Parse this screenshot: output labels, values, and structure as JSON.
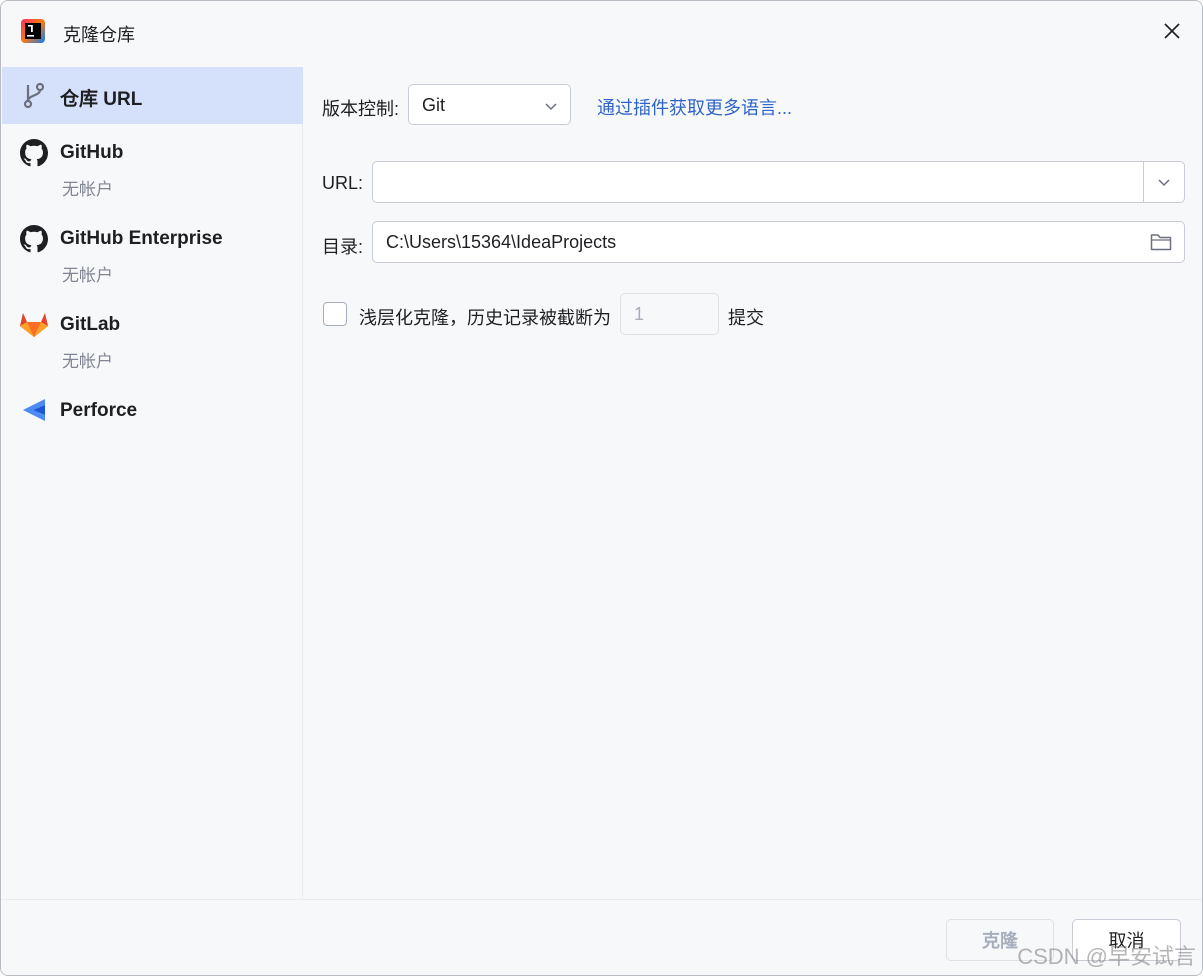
{
  "window": {
    "title": "克隆仓库"
  },
  "sidebar": {
    "items": [
      {
        "label": "仓库 URL",
        "sub": "",
        "icon": "branch-icon",
        "selected": true
      },
      {
        "label": "GitHub",
        "sub": "无帐户",
        "icon": "github-icon",
        "selected": false
      },
      {
        "label": "GitHub Enterprise",
        "sub": "无帐户",
        "icon": "github-icon",
        "selected": false
      },
      {
        "label": "GitLab",
        "sub": "无帐户",
        "icon": "gitlab-icon",
        "selected": false
      },
      {
        "label": "Perforce",
        "sub": "",
        "icon": "perforce-icon",
        "selected": false
      }
    ]
  },
  "form": {
    "vcs_label": "版本控制:",
    "vcs_value": "Git",
    "plugins_link": "通过插件获取更多语言...",
    "url_label": "URL:",
    "url_value": "",
    "dir_label": "目录:",
    "dir_value": "C:\\Users\\15364\\IdeaProjects",
    "shallow_label": "浅层化克隆，历史记录被截断为",
    "shallow_depth": "1",
    "shallow_suffix": "提交",
    "shallow_checked": false
  },
  "footer": {
    "clone_label": "克隆",
    "cancel_label": "取消"
  },
  "watermark": "CSDN @早安试言",
  "colors": {
    "selection": "#d5e1fb",
    "link": "#2f64c9",
    "background": "#f7f8fa"
  }
}
